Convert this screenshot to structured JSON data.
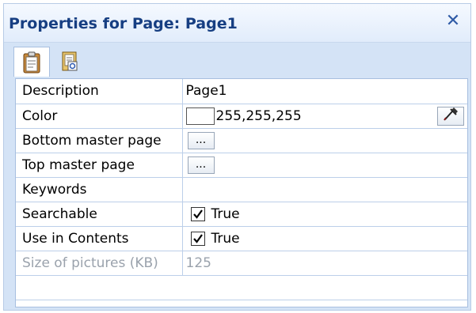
{
  "panel": {
    "title": "Properties for Page: Page1",
    "close_icon": "close-icon",
    "tabs": [
      {
        "icon": "clipboard-icon",
        "active": true
      },
      {
        "icon": "document-icon",
        "active": false
      }
    ]
  },
  "properties": [
    {
      "name": "Description",
      "value": "Page1"
    },
    {
      "name": "Color",
      "value": "255,255,255"
    },
    {
      "name": "Bottom master page",
      "button": "..."
    },
    {
      "name": "Top master page",
      "button": "..."
    },
    {
      "name": "Keywords",
      "value": ""
    },
    {
      "name": "Searchable",
      "checked": true,
      "value": "True"
    },
    {
      "name": "Use in Contents",
      "checked": true,
      "value": "True"
    },
    {
      "name": "Size of pictures (KB)",
      "value": "125"
    }
  ],
  "colors": {
    "title": "#163e82",
    "panel_bg": "#d4e3f6",
    "disabled_text": "#9aa2ac"
  }
}
